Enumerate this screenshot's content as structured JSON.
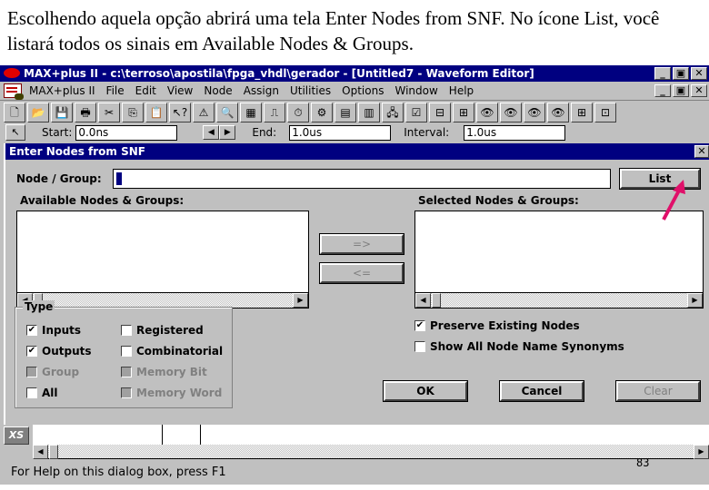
{
  "caption": "Escolhendo aquela opção abrirá uma tela Enter Nodes from SNF. No ícone List, você listará todos os sinais em Available Nodes & Groups.",
  "app": {
    "title": "MAX+plus II - c:\\terroso\\apostila\\fpga_vhdl\\gerador - [Untitled7 - Waveform Editor]",
    "window_buttons": [
      "_",
      "▣",
      "✕"
    ],
    "menu": [
      "MAX+plus II",
      "File",
      "Edit",
      "View",
      "Node",
      "Assign",
      "Utilities",
      "Options",
      "Window",
      "Help"
    ],
    "toolbar_icons": [
      {
        "name": "new-file-icon",
        "glyph": "🗋"
      },
      {
        "name": "open-folder-icon",
        "glyph": "📂"
      },
      {
        "name": "save-icon",
        "glyph": "💾"
      },
      {
        "name": "print-icon",
        "glyph": "🖶"
      },
      {
        "name": "cut-icon",
        "glyph": "✂"
      },
      {
        "name": "copy-icon",
        "glyph": "⎘"
      },
      {
        "name": "paste-icon",
        "glyph": "📋"
      },
      {
        "name": "context-help-icon",
        "glyph": "↖?"
      },
      {
        "name": "warning-icon",
        "glyph": "⚠"
      },
      {
        "name": "hierarchy-display-icon",
        "glyph": "🔍"
      },
      {
        "name": "floorplan-editor-icon",
        "glyph": "▦"
      },
      {
        "name": "compiler-icon",
        "glyph": "⎍"
      },
      {
        "name": "simulator-icon",
        "glyph": "⏱"
      },
      {
        "name": "timing-analyzer-icon",
        "glyph": "⚙"
      },
      {
        "name": "programmer-icon",
        "glyph": "▤"
      },
      {
        "name": "project-hierarchy-icon",
        "glyph": "▥"
      },
      {
        "name": "hierarchy-tree-icon",
        "glyph": "🖧"
      },
      {
        "name": "save-check-icon",
        "glyph": "☑"
      },
      {
        "name": "save-compile-icon",
        "glyph": "⊟"
      },
      {
        "name": "save-simulate-icon",
        "glyph": "⊞"
      },
      {
        "name": "find-node-icon",
        "glyph": "👁"
      },
      {
        "name": "find-node-ba-icon",
        "glyph": "👁"
      },
      {
        "name": "view-waveform-icon",
        "glyph": "👁"
      },
      {
        "name": "view-group-icon",
        "glyph": "👁"
      },
      {
        "name": "group-icon",
        "glyph": "⊞"
      },
      {
        "name": "ungroup-icon",
        "glyph": "⊡"
      }
    ],
    "timebar": {
      "start_label": "Start:",
      "start_value": "0.0ns",
      "end_label": "End:",
      "end_value": "1.0us",
      "interval_label": "Interval:",
      "interval_value": "1.0us"
    },
    "status": "For Help on this dialog box, press F1"
  },
  "dialog": {
    "title": "Enter Nodes from SNF",
    "close": "✕",
    "node_group_label": "Node / Group:",
    "node_group_value": "",
    "list_button": "List",
    "available_label": "Available Nodes & Groups:",
    "selected_label": "Selected Nodes & Groups:",
    "add_button": "=>",
    "remove_button": "<=",
    "type_group": {
      "title": "Type",
      "options": [
        {
          "label": "Inputs",
          "checked": true,
          "enabled": true
        },
        {
          "label": "Registered",
          "checked": false,
          "enabled": true
        },
        {
          "label": "Outputs",
          "checked": true,
          "enabled": true
        },
        {
          "label": "Combinatorial",
          "checked": false,
          "enabled": true
        },
        {
          "label": "Group",
          "checked": false,
          "enabled": false
        },
        {
          "label": "Memory Bit",
          "checked": false,
          "enabled": false
        },
        {
          "label": "All",
          "checked": false,
          "enabled": true
        },
        {
          "label": "Memory Word",
          "checked": false,
          "enabled": false
        }
      ]
    },
    "preserve_existing": {
      "label": "Preserve Existing Nodes",
      "checked": true
    },
    "show_synonyms": {
      "label": "Show All Node Name Synonyms",
      "checked": false
    },
    "ok_button": "OK",
    "cancel_button": "Cancel",
    "clear_button": "Clear"
  },
  "waveform": {
    "xs_label": "XS"
  },
  "page_number": "83",
  "colors": {
    "titlebar": "#000080",
    "face": "#c0c0c0",
    "arrow": "#e0106a"
  }
}
